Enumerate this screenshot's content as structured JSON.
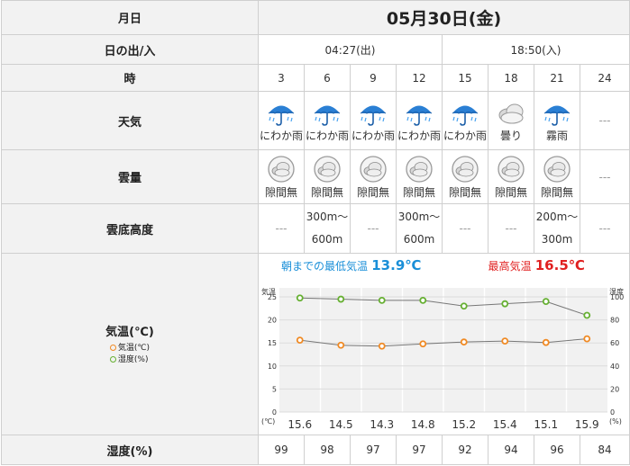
{
  "header": {
    "label": "月日",
    "date": "05月30日(金)"
  },
  "sun": {
    "label": "日の出/入",
    "sunrise": "04:27(出)",
    "sunset": "18:50(入)"
  },
  "time": {
    "label": "時",
    "hours": [
      "3",
      "6",
      "9",
      "12",
      "15",
      "18",
      "21",
      "24"
    ]
  },
  "weather": {
    "label": "天気",
    "items": [
      {
        "icon": "umbrella-rain-icon",
        "text": "にわか雨"
      },
      {
        "icon": "umbrella-rain-icon",
        "text": "にわか雨"
      },
      {
        "icon": "umbrella-rain-icon",
        "text": "にわか雨"
      },
      {
        "icon": "umbrella-rain-icon",
        "text": "にわか雨"
      },
      {
        "icon": "umbrella-rain-icon",
        "text": "にわか雨"
      },
      {
        "icon": "cloudy-icon",
        "text": "曇り"
      },
      {
        "icon": "umbrella-rain-icon",
        "text": "霧雨"
      },
      {
        "icon": "",
        "text": "---"
      }
    ]
  },
  "cloud_cover": {
    "label": "雲量",
    "items": [
      "隙間無",
      "隙間無",
      "隙間無",
      "隙間無",
      "隙間無",
      "隙間無",
      "隙間無",
      "---"
    ]
  },
  "cloud_base": {
    "label": "雲底高度",
    "items": [
      {
        "top": "---",
        "bottom": ""
      },
      {
        "top": "300m〜",
        "bottom": "600m"
      },
      {
        "top": "---",
        "bottom": ""
      },
      {
        "top": "300m〜",
        "bottom": "600m"
      },
      {
        "top": "---",
        "bottom": ""
      },
      {
        "top": "---",
        "bottom": ""
      },
      {
        "top": "200m〜",
        "bottom": "300m"
      },
      {
        "top": "---",
        "bottom": ""
      }
    ]
  },
  "temperature": {
    "label": "気温(℃)",
    "legend_temp": "気温(℃)",
    "legend_humidity": "湿度(%)",
    "min_label": "朝までの最低気温",
    "min_value": "13.9℃",
    "max_label": "最高気温",
    "max_value": "16.5℃",
    "values": [
      "15.6",
      "14.5",
      "14.3",
      "14.8",
      "15.2",
      "15.4",
      "15.1",
      "15.9"
    ]
  },
  "humidity": {
    "label": "湿度(%)",
    "values": [
      "99",
      "98",
      "97",
      "97",
      "92",
      "94",
      "96",
      "84"
    ]
  },
  "colors": {
    "temp": "#f08a24",
    "humidity": "#66b032",
    "min": "#1a8fd8",
    "max": "#e02020"
  },
  "chart_data": {
    "type": "line",
    "x": [
      "3",
      "6",
      "9",
      "12",
      "15",
      "18",
      "21",
      "24"
    ],
    "series": [
      {
        "name": "気温(℃)",
        "values": [
          15.6,
          14.5,
          14.3,
          14.8,
          15.2,
          15.4,
          15.1,
          15.9
        ],
        "axis": "left"
      },
      {
        "name": "湿度(%)",
        "values": [
          99,
          98,
          97,
          97,
          92,
          94,
          96,
          84
        ],
        "axis": "right"
      }
    ],
    "ylabel_left": "気温",
    "ylabel_right": "湿度",
    "ylim_left": [
      0,
      25
    ],
    "yticks_left": [
      "25",
      "20",
      "15",
      "10",
      "5",
      "0"
    ],
    "ylim_right": [
      0,
      100
    ],
    "yticks_right": [
      "100",
      "80",
      "60",
      "40",
      "20",
      "0"
    ],
    "unit_left": "(℃)",
    "unit_right": "(%)",
    "grid": true
  }
}
